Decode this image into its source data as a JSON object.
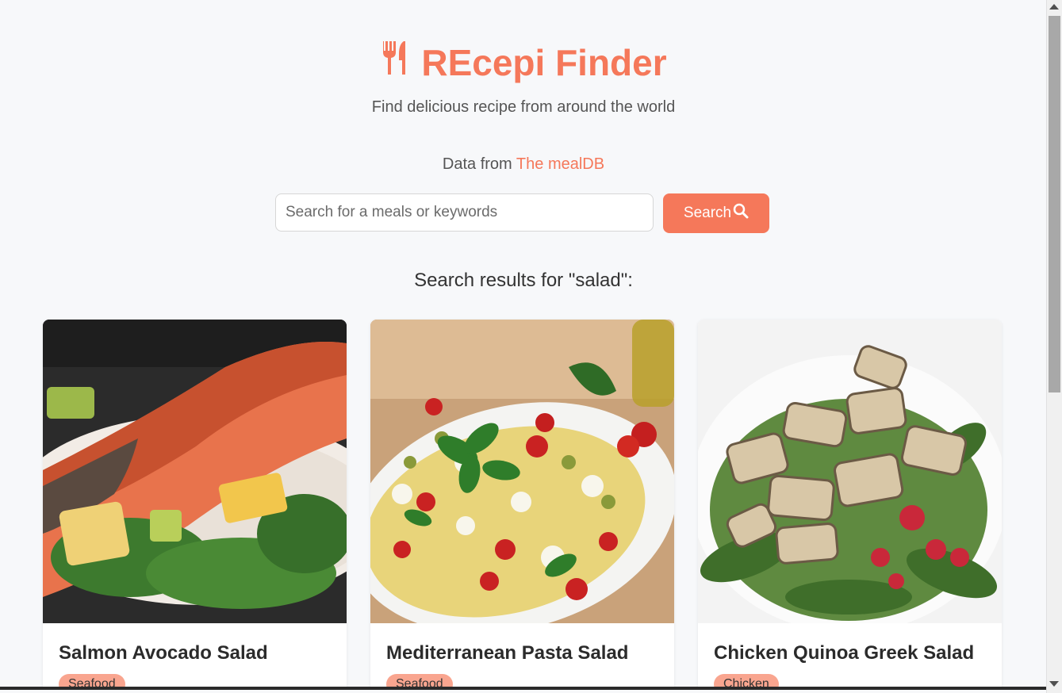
{
  "header": {
    "title": "REcepi Finder",
    "subtitle": "Find delicious recipe from around the world",
    "source_prefix": "Data from",
    "source_link": "The mealDB"
  },
  "search": {
    "placeholder": "Search for a meals or keywords",
    "value": "",
    "button_label": "Search"
  },
  "results_heading": "Search results for \"salad\":",
  "cards": [
    {
      "title": "Salmon Avocado Salad",
      "category": "Seafood"
    },
    {
      "title": "Mediterranean Pasta Salad",
      "category": "Seafood"
    },
    {
      "title": "Chicken Quinoa Greek Salad",
      "category": "Chicken"
    }
  ],
  "colors": {
    "accent": "#f5785a",
    "badge": "#f9a58f",
    "background": "#f7f8fa"
  }
}
